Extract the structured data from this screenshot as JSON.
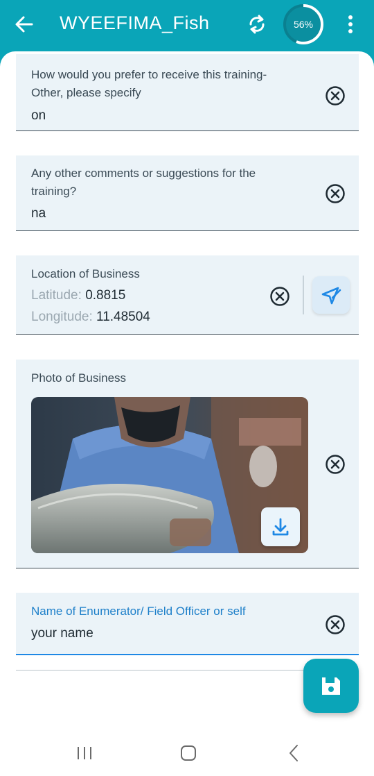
{
  "app_bar": {
    "title": "WYEEFIMA_Fish",
    "progress": {
      "percent_label": "56%",
      "value": 0.56
    },
    "colors": {
      "accent": "#0aa5b8"
    }
  },
  "fields": {
    "training_other": {
      "label_line1": "How would you prefer to receive this training-",
      "label_line2": "Other, please specify",
      "value": "on"
    },
    "comments": {
      "label_line1": "Any other comments or suggestions for the",
      "label_line2": "training?",
      "value": "na"
    },
    "location": {
      "label": "Location of Business",
      "latitude_label": "Latitude:",
      "latitude_value": "0.8815",
      "longitude_label": "Longitude:",
      "longitude_value": "11.48504"
    },
    "photo": {
      "label": "Photo of Business"
    },
    "enumerator": {
      "label": "Name of Enumerator/ Field Officer or self",
      "value": "your name"
    }
  },
  "icons": {
    "back": "arrow-left-icon",
    "sync": "sync-icon",
    "more": "more-vertical-icon",
    "clear": "close-circle-icon",
    "geo": "location-edit-icon",
    "download": "download-icon",
    "save": "save-icon"
  }
}
